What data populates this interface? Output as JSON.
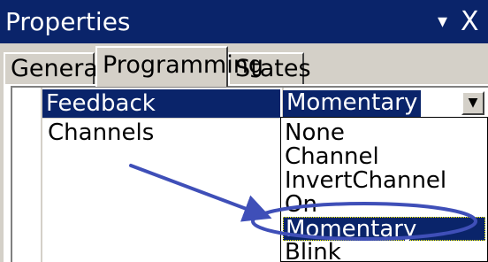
{
  "window": {
    "title": "Properties",
    "pin_glyph": "▾",
    "close_glyph": "X"
  },
  "tabs": [
    {
      "label": "General"
    },
    {
      "label": "Programming"
    },
    {
      "label": "States"
    }
  ],
  "properties": [
    {
      "name": "Feedback",
      "value": "Momentary"
    },
    {
      "name": "Channels",
      "value": ""
    }
  ],
  "dropdown": {
    "button_glyph": "▼",
    "options": [
      "None",
      "Channel",
      "InvertChannel",
      "On",
      "Momentary",
      "Blink"
    ],
    "highlighted": "Momentary"
  },
  "annotation": {
    "color": "#3f4fb8"
  }
}
